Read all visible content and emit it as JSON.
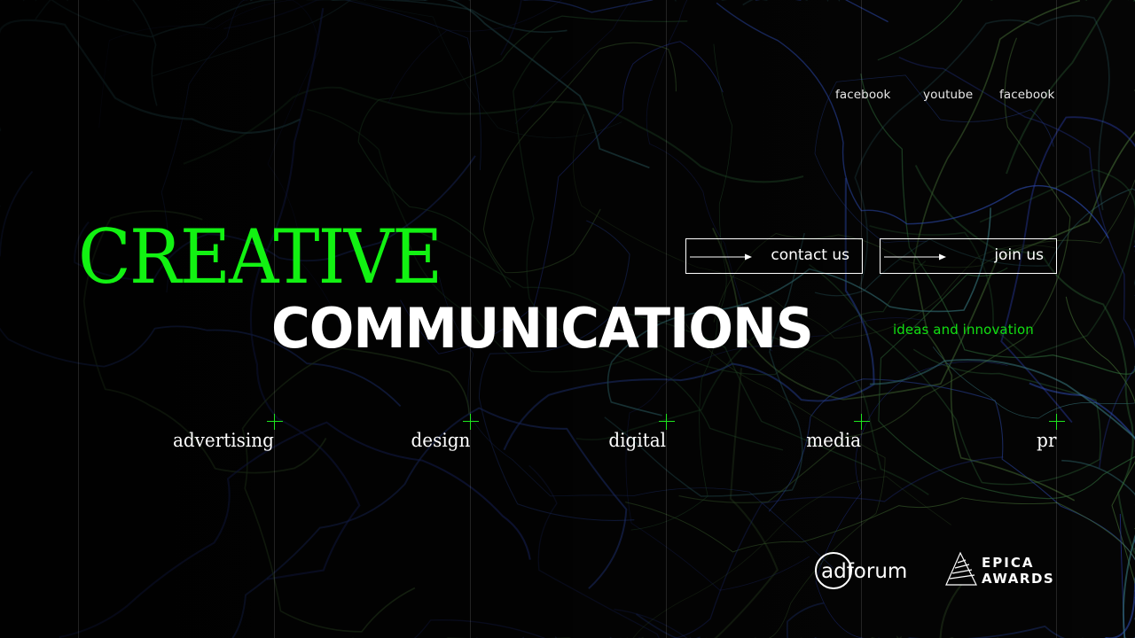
{
  "colors": {
    "background": "#050505",
    "accent_green": "#12f212",
    "text_white": "#ffffff",
    "swirl_green": "#2f6b3a",
    "swirl_blue": "#2b3fb0",
    "swirl_teal": "#3a7f86"
  },
  "nav": {
    "social_links": [
      {
        "label": "facebook",
        "icon": "facebook-link"
      },
      {
        "label": "youtube",
        "icon": "youtube-link"
      },
      {
        "label": "facebook",
        "icon": "facebook-link"
      }
    ]
  },
  "hero": {
    "title_line1": "CREATIVE",
    "title_line2": "COMMUNICATIONS",
    "tagline": "ideas and innovation"
  },
  "cta": {
    "contact_label": "contact us",
    "join_label": "join us",
    "arrow_icon": "arrow-right-icon"
  },
  "services": [
    {
      "label": "advertising"
    },
    {
      "label": "design"
    },
    {
      "label": "digital"
    },
    {
      "label": "media"
    },
    {
      "label": "pr"
    }
  ],
  "partners": {
    "adforum_logo": "adforum",
    "epica_line1": "EPICA",
    "epica_line2": "AWARDS"
  }
}
